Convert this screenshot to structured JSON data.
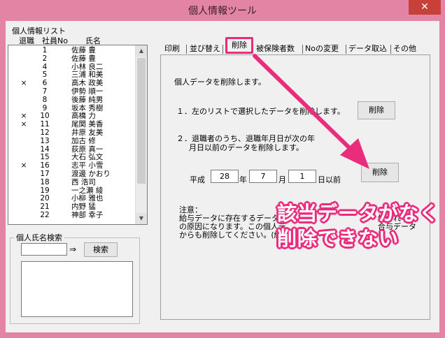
{
  "window": {
    "title": "個人情報ツール",
    "close_glyph": "✕"
  },
  "list": {
    "group_label": "個人情報リスト",
    "headers": {
      "retired": "退職",
      "number": "社員No",
      "name": "氏名"
    },
    "rows": [
      {
        "mark": "",
        "no": "1",
        "name": "佐藤 豊"
      },
      {
        "mark": "",
        "no": "2",
        "name": "佐藤 豊"
      },
      {
        "mark": "",
        "no": "4",
        "name": "小林 良二"
      },
      {
        "mark": "",
        "no": "5",
        "name": "三浦 和美"
      },
      {
        "mark": "×",
        "no": "6",
        "name": "高木 政美"
      },
      {
        "mark": "",
        "no": "7",
        "name": "伊勢 順一"
      },
      {
        "mark": "",
        "no": "8",
        "name": "後藤 純男"
      },
      {
        "mark": "",
        "no": "9",
        "name": "坂本 秀樹"
      },
      {
        "mark": "×",
        "no": "10",
        "name": "高橋 力"
      },
      {
        "mark": "×",
        "no": "11",
        "name": "尾関 美香"
      },
      {
        "mark": "",
        "no": "12",
        "name": "井原 友美"
      },
      {
        "mark": "",
        "no": "13",
        "name": "加古 修"
      },
      {
        "mark": "",
        "no": "14",
        "name": "荻原 真一"
      },
      {
        "mark": "",
        "no": "15",
        "name": "大石 弘文"
      },
      {
        "mark": "×",
        "no": "16",
        "name": "志平 小雪"
      },
      {
        "mark": "",
        "no": "17",
        "name": "渡邊 かおり"
      },
      {
        "mark": "",
        "no": "18",
        "name": "西 浩司"
      },
      {
        "mark": "",
        "no": "19",
        "name": "一之瀬 綾"
      },
      {
        "mark": "",
        "no": "20",
        "name": "小柳 雅也"
      },
      {
        "mark": "",
        "no": "21",
        "name": "内野 猛"
      },
      {
        "mark": "",
        "no": "22",
        "name": "神部 幸子"
      }
    ]
  },
  "search": {
    "group_label": "個人氏名検索",
    "arrow": "⇒",
    "button": "検索",
    "value": ""
  },
  "tabs": [
    "印刷",
    "並び替え",
    "削除",
    "被保険者数",
    "Noの変更",
    "データ取込",
    "その他"
  ],
  "panel": {
    "intro": "個人データを削除します。",
    "step1": "１．左のリストで選択したデータを削除します。",
    "step1_button": "削除",
    "step2_line1": "２．退職者のうち、退職年月日が次の年",
    "step2_line2": "月日以前のデータを削除します。",
    "era": "平成",
    "year": "28",
    "year_unit": "年",
    "month": "7",
    "month_unit": "月",
    "day": "1",
    "day_unit": "日以前",
    "step2_button": "削除",
    "note_title": "注意：",
    "note_line1": "給与データに存在するデータ",
    "note_line1_tail": "性がれ",
    "note_line2": "の原因になります。この個人デ",
    "note_line2_tail": "合与データ",
    "note_line3": "からも削除してください。(給与"
  },
  "annotation": {
    "line1": "該当データがなく",
    "line2": "削除できない",
    "color": "#ea2c7d"
  }
}
